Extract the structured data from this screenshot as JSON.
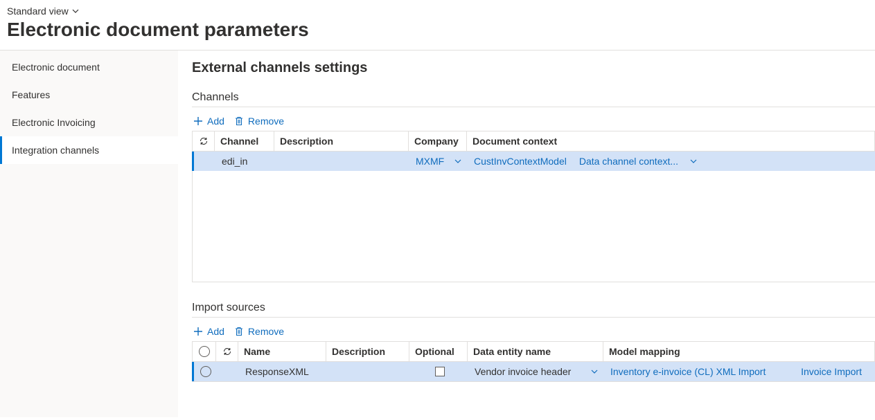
{
  "header": {
    "view_label": "Standard view",
    "page_title": "Electronic document parameters"
  },
  "sidebar": {
    "items": [
      {
        "label": "Electronic document",
        "selected": false
      },
      {
        "label": "Features",
        "selected": false
      },
      {
        "label": "Electronic Invoicing",
        "selected": false
      },
      {
        "label": "Integration channels",
        "selected": true
      }
    ]
  },
  "main": {
    "title": "External channels settings",
    "channels_section": {
      "header": "Channels",
      "add_label": "Add",
      "remove_label": "Remove",
      "columns": {
        "channel": "Channel",
        "description": "Description",
        "company": "Company",
        "document_context": "Document context"
      },
      "rows": [
        {
          "channel": "edi_in",
          "description": "",
          "company": "MXMF",
          "document_context_model": "CustInvContextModel",
          "document_context_config": "Data channel context..."
        }
      ]
    },
    "import_section": {
      "header": "Import sources",
      "add_label": "Add",
      "remove_label": "Remove",
      "columns": {
        "name": "Name",
        "description": "Description",
        "optional": "Optional",
        "data_entity_name": "Data entity name",
        "model_mapping": "Model mapping"
      },
      "rows": [
        {
          "name": "ResponseXML",
          "description": "",
          "optional": false,
          "data_entity_name": "Vendor invoice header",
          "model_mapping_format": "Inventory e-invoice (CL) XML Import",
          "model_mapping_config": "Invoice Import"
        }
      ]
    }
  }
}
